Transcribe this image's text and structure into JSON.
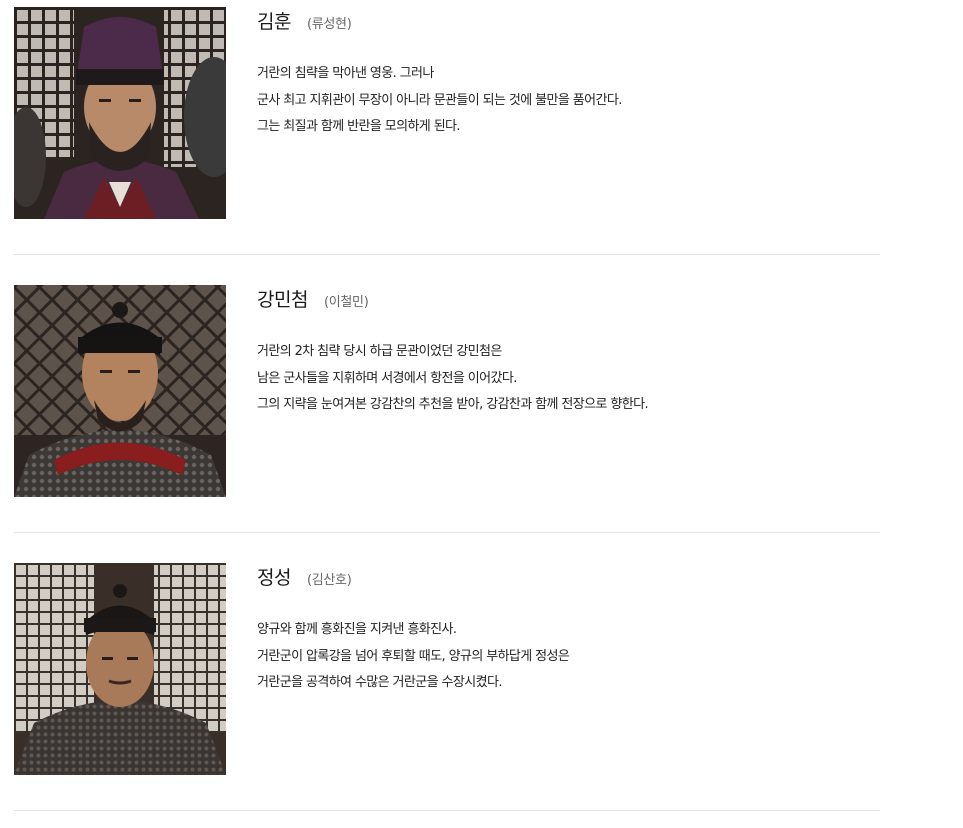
{
  "cast": [
    {
      "character": "김훈",
      "actor": "(류성현)",
      "description": [
        "거란의 침략을 막아낸 영웅. 그러나",
        "군사 최고 지휘관이 무장이 아니라 문관들이 되는 것에 불만을 품어간다.",
        "그는 최질과 함께 반란을 모의하게 된다."
      ]
    },
    {
      "character": "강민첨",
      "actor": "(이철민)",
      "description": [
        "거란의 2차 침략 당시 하급 문관이었던 강민첨은",
        "남은 군사들을 지휘하며 서경에서 항전을 이어갔다.",
        "그의 지략을 눈여겨본 강감찬의 추천을 받아, 강감찬과 함께 전장으로 향한다."
      ]
    },
    {
      "character": "정성",
      "actor": "(김산호)",
      "description": [
        "양규와 함께 흥화진을 지켜낸 흥화진사.",
        "거란군이 압록강을 넘어 후퇴할 때도, 양규의 부하답게 정성은",
        "거란군을 공격하여 수많은 거란군을 수장시켰다."
      ]
    }
  ]
}
